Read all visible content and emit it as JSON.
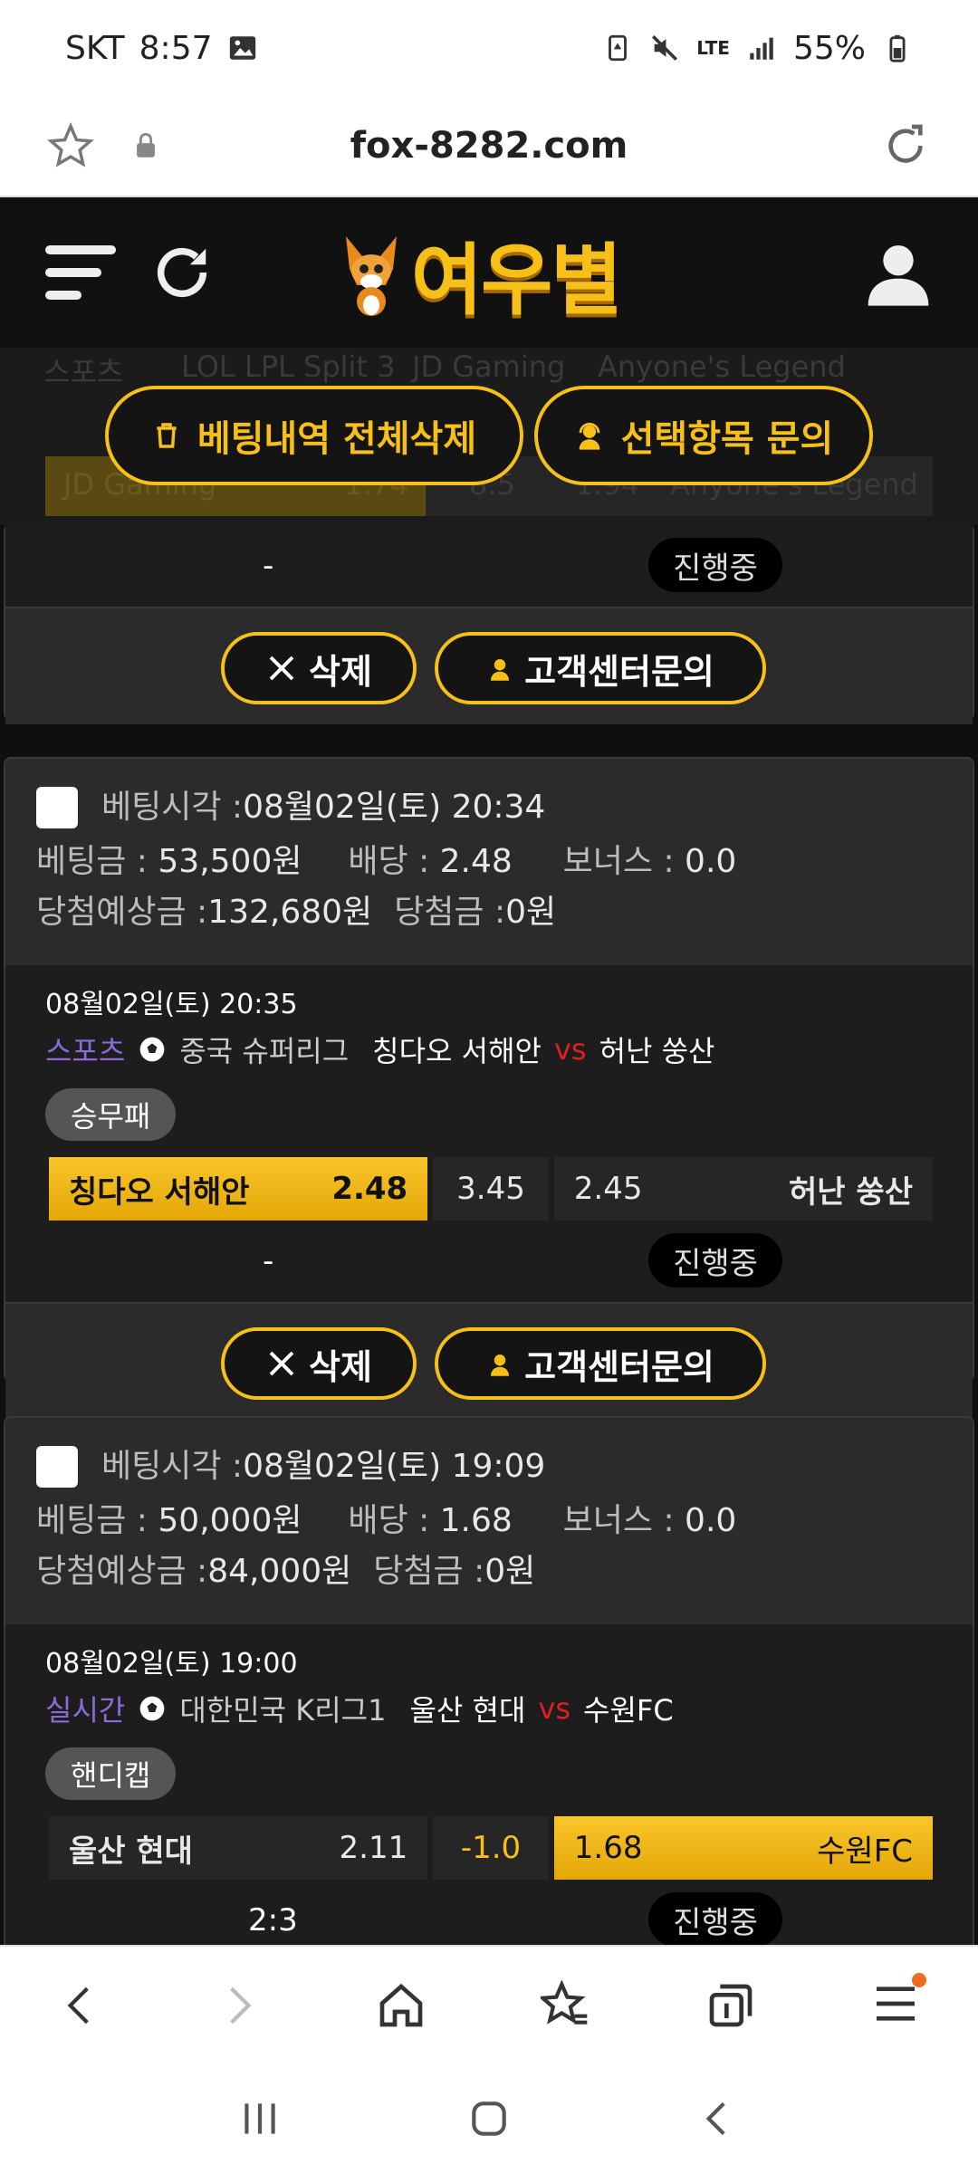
{
  "status_bar": {
    "carrier": "SKT",
    "time": "8:57",
    "network": "LTE",
    "battery": "55%"
  },
  "browser": {
    "url": "fox-8282.com"
  },
  "site": {
    "logo_text": "여우별",
    "ghost_row": {
      "sport": "스포츠",
      "league": "LOL LPL Split 3",
      "home": "JD Gaming",
      "away": "Anyone's Legend",
      "home_odd": "1.74",
      "mid": "8.5",
      "away_odd": "1.94"
    }
  },
  "actions": {
    "delete_all": "베팅내역 전체삭제",
    "inquire_selected": "선택항목 문의"
  },
  "partial_card": {
    "result": "-",
    "status": "진행중",
    "delete_label": "삭제",
    "support_label": "고객센터문의"
  },
  "bets": [
    {
      "bet_time_label": "베팅시각 :",
      "bet_time": "08월02일(토) 20:34",
      "amount_label": "베팅금 :",
      "amount": "53,500원",
      "odds_label": "배당 :",
      "odds": "2.48",
      "bonus_label": "보너스 :",
      "bonus": "0.0",
      "expected_label": "당첨예상금 :",
      "expected": "132,680원",
      "won_label": "당첨금 :",
      "won": "0원",
      "match_time": "08월02일(토) 20:35",
      "category": "스포츠",
      "league": "중국 슈퍼리그",
      "home": "칭다오 서해안",
      "vs": "vs",
      "away": "허난 쑹산",
      "market": "승무패",
      "home_odd": "2.48",
      "mid": "3.45",
      "away_odd": "2.45",
      "selected": "home",
      "result": "-",
      "status": "진행중",
      "delete_label": "삭제",
      "support_label": "고객센터문의"
    },
    {
      "bet_time_label": "베팅시각 :",
      "bet_time": "08월02일(토) 19:09",
      "amount_label": "베팅금 :",
      "amount": "50,000원",
      "odds_label": "배당 :",
      "odds": "1.68",
      "bonus_label": "보너스 :",
      "bonus": "0.0",
      "expected_label": "당첨예상금 :",
      "expected": "84,000원",
      "won_label": "당첨금 :",
      "won": "0원",
      "match_time": "08월02일(토) 19:00",
      "category": "실시간",
      "league": "대한민국 K리그1",
      "home": "울산 현대",
      "vs": "vs",
      "away": "수원FC",
      "market": "핸디캡",
      "home_odd": "2.11",
      "mid": "-1.0",
      "away_odd": "1.68",
      "selected": "away",
      "result": "2:3",
      "status": "진행중"
    }
  ],
  "colors": {
    "accent": "#f6c018",
    "vs": "#e02020",
    "category": "#8a6bd8"
  }
}
